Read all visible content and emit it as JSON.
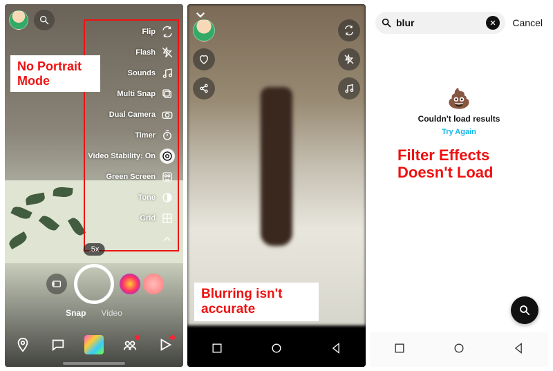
{
  "annotations": {
    "screen1": "No Portrait\nMode",
    "screen2": "Blurring isn't\naccurate",
    "screen3": "Filter Effects\nDoesn't Load"
  },
  "screen1": {
    "tools": [
      {
        "label": "Flip",
        "icon": "flip"
      },
      {
        "label": "Flash",
        "icon": "flash-off"
      },
      {
        "label": "Sounds",
        "icon": "music"
      },
      {
        "label": "Multi Snap",
        "icon": "multisnap"
      },
      {
        "label": "Dual Camera",
        "icon": "dualcam"
      },
      {
        "label": "Timer",
        "icon": "timer"
      },
      {
        "label": "Video Stability: On",
        "icon": "stability",
        "highlight": true
      },
      {
        "label": "Green Screen",
        "icon": "greenscreen"
      },
      {
        "label": "Tone",
        "icon": "tone"
      },
      {
        "label": "Grid",
        "icon": "grid"
      }
    ],
    "zoom": ".5x",
    "modes": {
      "snap": "Snap",
      "video": "Video"
    }
  },
  "screen3": {
    "search_value": "blur",
    "cancel": "Cancel",
    "empty_emoji": "💩",
    "empty_message": "Couldn't load results",
    "try_again": "Try Again"
  }
}
